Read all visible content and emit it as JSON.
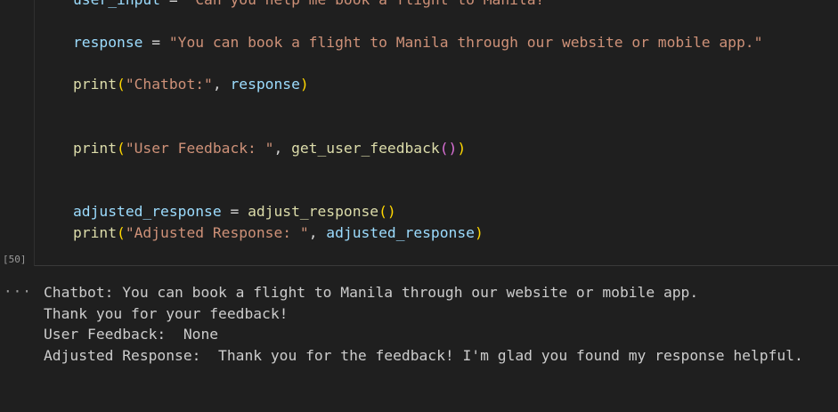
{
  "code": {
    "line1_var": "user_input",
    "line1_eq": " = ",
    "line1_str": "\"Can you help me book a flight to Manila?\"",
    "line2_var": "response",
    "line2_eq": " = ",
    "line2_str": "\"You can book a flight to Manila through our website or mobile app.\"",
    "line3_fn": "print",
    "line3_open": "(",
    "line3_str": "\"Chatbot:\"",
    "line3_sep": ", ",
    "line3_arg": "response",
    "line3_close": ")",
    "line4_fn": "print",
    "line4_open": "(",
    "line4_str": "\"User Feedback: \"",
    "line4_sep": ", ",
    "line4_call": "get_user_feedback",
    "line4_inner": "()",
    "line4_close": ")",
    "line5_var": "adjusted_response",
    "line5_eq": " = ",
    "line5_fn": "adjust_response",
    "line5_parens": "()",
    "line6_fn": "print",
    "line6_open": "(",
    "line6_str": "\"Adjusted Response: \"",
    "line6_sep": ", ",
    "line6_arg": "adjusted_response",
    "line6_close": ")"
  },
  "cell": {
    "execution_count": "[50]",
    "output_menu": "···"
  },
  "output": [
    "Chatbot: You can book a flight to Manila through our website or mobile app.",
    "Thank you for your feedback!",
    "User Feedback:  None",
    "Adjusted Response:  Thank you for the feedback! I'm glad you found my response helpful."
  ]
}
